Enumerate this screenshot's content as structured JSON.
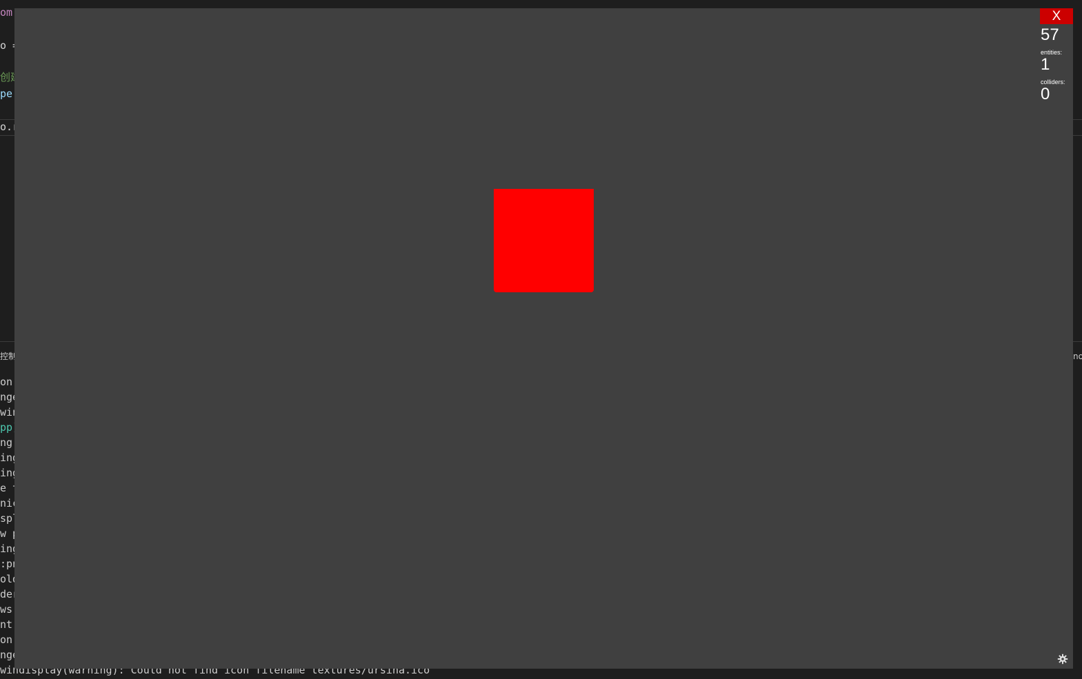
{
  "editor": {
    "code_lines": [
      {
        "text": "om",
        "class": "c-pink"
      },
      {
        "text": "o =",
        "class": ""
      },
      {
        "text": "创建",
        "class": "c-green"
      },
      {
        "text": "pe",
        "class": "c-blue"
      },
      {
        "text": "o.r",
        "class": ""
      }
    ]
  },
  "terminal": {
    "tab_label": "控制",
    "right_edge_label": "no",
    "lines": [
      {
        "text": "on",
        "class": ""
      },
      {
        "text": "nge",
        "class": ""
      },
      {
        "text": "win",
        "class": ""
      },
      {
        "text": "pp)",
        "class": "c-teal"
      },
      {
        "text": "ng",
        "class": ""
      },
      {
        "text": "ing",
        "class": ""
      },
      {
        "text": "ing",
        "class": ""
      },
      {
        "text": "e t",
        "class": ""
      },
      {
        "text": "nic",
        "class": ""
      },
      {
        "text": "spl",
        "class": ""
      },
      {
        "text": "w p",
        "class": ""
      },
      {
        "text": "ing",
        "class": ""
      },
      {
        "text": ":pn",
        "class": ""
      },
      {
        "text": "old",
        "class": ""
      },
      {
        "text": "der",
        "class": ""
      },
      {
        "text": "ws",
        "class": ""
      },
      {
        "text": "nt",
        "class": ""
      },
      {
        "text": "on",
        "class": ""
      },
      {
        "text": "nge",
        "class": ""
      }
    ],
    "bottom_line": "windisplay(warning): Could not find icon filename textures/ursina.ico"
  },
  "game_window": {
    "close_label": "X",
    "fps": "57",
    "entities_label": "entities:",
    "entities_value": "1",
    "colliders_label": "colliders:",
    "colliders_value": "0",
    "background_color": "#404040",
    "entity_color": "#ff0000",
    "settings_icon": "gear-icon"
  }
}
